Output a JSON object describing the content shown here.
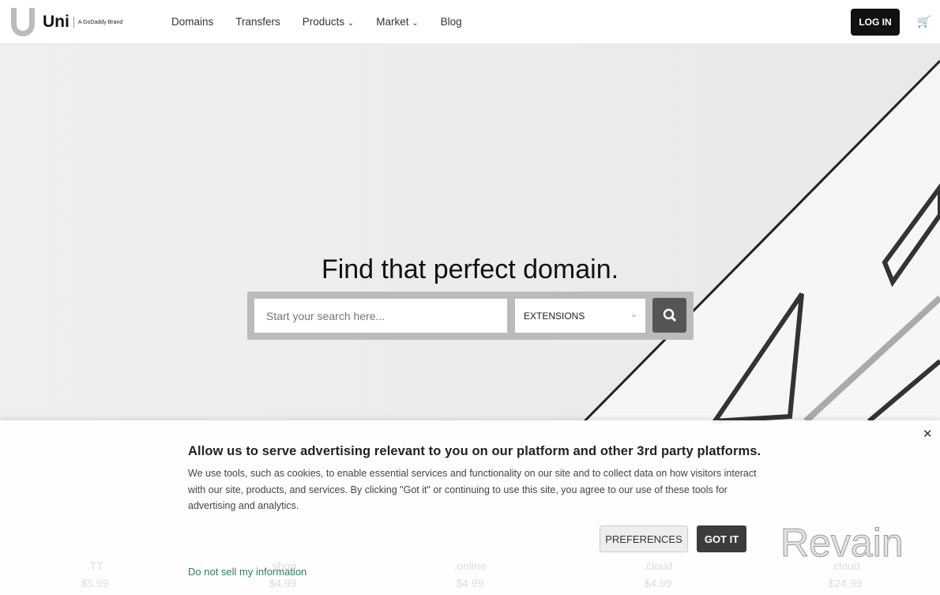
{
  "nav": {
    "logo": "Uni",
    "brand": "A GoDaddy Brand",
    "items": [
      "Domains",
      "Transfers",
      "Products",
      "Market",
      "Blog"
    ],
    "login": "LOG IN"
  },
  "hero": {
    "title": "Find that perfect domain.",
    "search_placeholder": "Start your search here...",
    "select_value": "EXTENSIONS"
  },
  "cookie": {
    "title": "Allow us to serve advertising relevant to you on our platform and other 3rd party platforms.",
    "body": "We use tools, such as cookies, to enable essential services and functionality on our site and to collect data on how visitors interact with our site, products, and services. By clicking \"Got it\" or continuing to use this site, you agree to our use of these tools for advertising and analytics.",
    "preferences": "PREFERENCES",
    "got_it": "GOT IT",
    "do_not_sell": "Do not sell my information"
  },
  "tlds": [
    {
      "name": ".TT",
      "price": "$5.99"
    },
    {
      "name": ".shop",
      "price": "$4.99"
    },
    {
      "name": ".online",
      "price": "$4.99"
    },
    {
      "name": ".cloud",
      "price": "$4.99"
    },
    {
      "name": ".cloud",
      "price": "$24.99"
    }
  ],
  "watermark": "Revain"
}
